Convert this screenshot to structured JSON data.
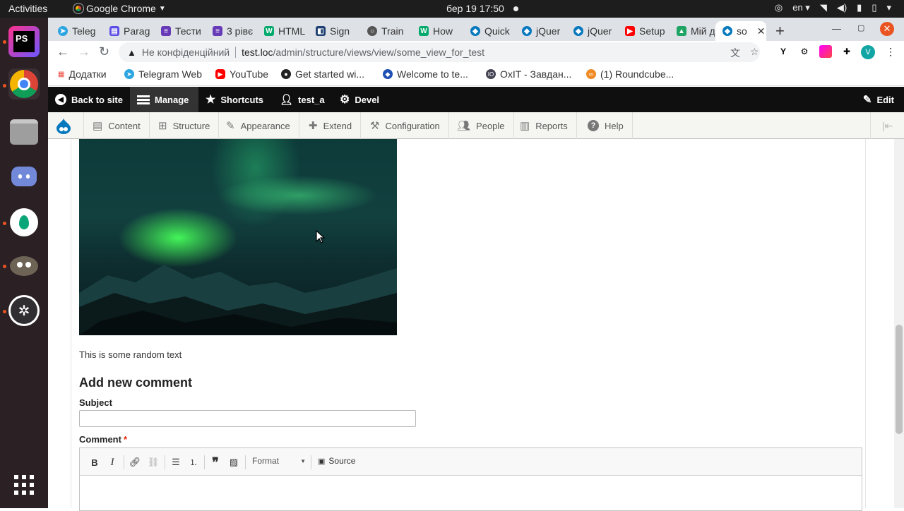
{
  "gnome": {
    "activities": "Activities",
    "app_name": "Google Chrome",
    "clock": "бер 19  17:50",
    "lang": "en"
  },
  "dock": {
    "items": [
      {
        "name": "phpstorm",
        "label": "PS"
      },
      {
        "name": "chrome"
      },
      {
        "name": "files"
      },
      {
        "name": "discord"
      },
      {
        "name": "app-green"
      },
      {
        "name": "gimp"
      },
      {
        "name": "obs"
      },
      {
        "name": "show-apps"
      }
    ]
  },
  "tabs": [
    {
      "label": "Teleg",
      "color": "#2ca5e0",
      "glyph": "➤"
    },
    {
      "label": "Parag",
      "color": "#5c4ee5",
      "glyph": "▤"
    },
    {
      "label": "Тести",
      "color": "#673ab7",
      "glyph": "≡"
    },
    {
      "label": "3 рівє",
      "color": "#673ab7",
      "glyph": "≡"
    },
    {
      "label": "HTML",
      "color": "#04aa6d",
      "glyph": "W"
    },
    {
      "label": "Sign",
      "color": "#1d3f72",
      "glyph": "◧"
    },
    {
      "label": "Train",
      "color": "#555555",
      "glyph": "○"
    },
    {
      "label": "How",
      "color": "#04aa6d",
      "glyph": "W"
    },
    {
      "label": "Quick",
      "color": "#0678be",
      "glyph": "◆"
    },
    {
      "label": "jQuer",
      "color": "#0678be",
      "glyph": "◆"
    },
    {
      "label": "jQuer",
      "color": "#0678be",
      "glyph": "◆"
    },
    {
      "label": "Setup",
      "color": "#ff0000",
      "glyph": "▶"
    },
    {
      "label": "Мій д",
      "color": "#1fa463",
      "glyph": "▲"
    },
    {
      "label": "so",
      "color": "#0678be",
      "glyph": "◆",
      "active": true
    }
  ],
  "toolbar": {
    "insecure_label": "Не конфіденційний",
    "url_host": "test.loc",
    "url_path": "/admin/structure/views/view/some_view_for_test",
    "profile_initial": "V"
  },
  "bookmarks": [
    {
      "label": "Додатки"
    },
    {
      "label": "Telegram Web"
    },
    {
      "label": "YouTube"
    },
    {
      "label": "Get started wi..."
    },
    {
      "label": "Welcome to te..."
    },
    {
      "label": "OxIT - Завдан..."
    },
    {
      "label": "(1) Roundcube..."
    }
  ],
  "drupal_toolbar": {
    "back_to_site": "Back to site",
    "manage": "Manage",
    "shortcuts": "Shortcuts",
    "user": "test_a",
    "devel": "Devel",
    "edit": "Edit"
  },
  "drupal_tray": {
    "items": [
      "Content",
      "Structure",
      "Appearance",
      "Extend",
      "Configuration",
      "People",
      "Reports",
      "Help"
    ]
  },
  "content": {
    "random_text": "This is some random text",
    "comment_heading": "Add new comment",
    "subject_label": "Subject",
    "comment_label": "Comment",
    "required_marker": "*",
    "editor": {
      "format_label": "Format",
      "source_label": "Source"
    }
  },
  "colors": {
    "drupal_bar": "#0f0f0f",
    "tray_bg": "#f5f5f2",
    "required": "#e32700",
    "ubuntu_accent": "#e95420"
  }
}
